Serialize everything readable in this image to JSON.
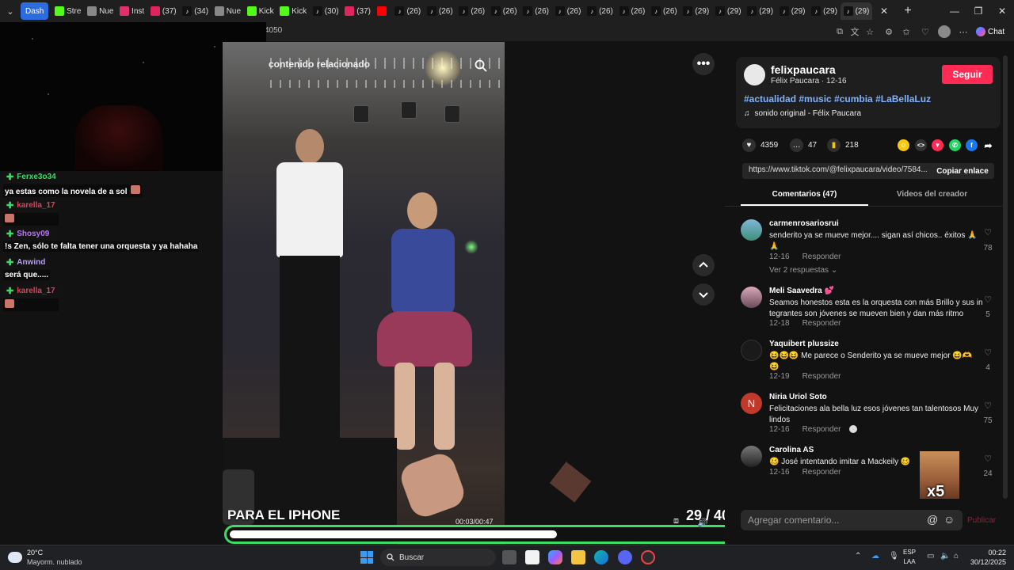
{
  "browser": {
    "tabs": [
      {
        "label": "Dash",
        "icon": "dashboard-icon"
      },
      {
        "label": "Stre",
        "icon": "kick-icon"
      },
      {
        "label": "Nue",
        "icon": "newtab-icon"
      },
      {
        "label": "Inst",
        "icon": "instagram-icon"
      },
      {
        "label": "(37)",
        "icon": "red-dot-icon"
      },
      {
        "label": "(34)",
        "icon": "tiktok-icon"
      },
      {
        "label": "Nue",
        "icon": "newtab-icon"
      },
      {
        "label": "Kick",
        "icon": "kick-icon"
      },
      {
        "label": "Kick",
        "icon": "kick-icon"
      },
      {
        "label": "(30)",
        "icon": "tiktok-icon"
      },
      {
        "label": "(37)",
        "icon": "red-dot-icon"
      },
      {
        "label": "",
        "icon": "youtube-icon"
      },
      {
        "label": "(26)",
        "icon": "tiktok-icon"
      },
      {
        "label": "(26)",
        "icon": "tiktok-icon"
      },
      {
        "label": "(26)",
        "icon": "tiktok-icon"
      },
      {
        "label": "(26)",
        "icon": "tiktok-icon"
      },
      {
        "label": "(26)",
        "icon": "tiktok-icon"
      },
      {
        "label": "(26)",
        "icon": "tiktok-icon"
      },
      {
        "label": "(26)",
        "icon": "tiktok-icon"
      },
      {
        "label": "(26)",
        "icon": "tiktok-icon"
      },
      {
        "label": "(26)",
        "icon": "tiktok-icon"
      },
      {
        "label": "(29)",
        "icon": "tiktok-icon"
      },
      {
        "label": "(29)",
        "icon": "tiktok-icon"
      },
      {
        "label": "(29)",
        "icon": "tiktok-icon"
      },
      {
        "label": "(29)",
        "icon": "tiktok-icon"
      },
      {
        "label": "(29)",
        "icon": "tiktok-icon"
      },
      {
        "label": "(29)",
        "icon": "tiktok-icon"
      }
    ],
    "address_fragment": "4050",
    "chat_label": "Chat"
  },
  "stream_chat": [
    {
      "user": "Ferxe3o34",
      "user_color": "#3ddc63",
      "message": "ya estas como la novela de a sol"
    },
    {
      "user": "karella_17",
      "user_color": "#e0405a",
      "message": ""
    },
    {
      "user": "Shosy09",
      "user_color": "#c071ff",
      "message": "!s Zen, sólo te falta tener una orquesta y ya hahaha"
    },
    {
      "user": "Anwind",
      "user_color": "#b99bff",
      "message": "será que....."
    },
    {
      "user": "karella_17",
      "user_color": "#e0405a",
      "message": ""
    }
  ],
  "video": {
    "related_label": "contenido relacionado",
    "caption": "PARA EL IPHONE",
    "time": "00:03/00:47",
    "progress": 0.64,
    "counter": "29 / 40"
  },
  "creator": {
    "username": "felixpaucara",
    "display_name": "Félix Paucara",
    "date": "12-16",
    "follow_label": "Seguir",
    "hashtags": "#actualidad #music #cumbia #LaBellaLuz",
    "sound": "sonido original - Félix Paucara"
  },
  "stats": {
    "likes": "4359",
    "comments": "47",
    "saves": "218"
  },
  "share": {
    "link": "https://www.tiktok.com/@felixpaucara/video/7584...",
    "copy_label": "Copiar enlace"
  },
  "tabs": {
    "comments": "Comentarios (47)",
    "creator_videos": "Videos del creador"
  },
  "comments": [
    {
      "user": "carmenrosariosrui",
      "text": "senderito ya se mueve mejor.... sigan así chicos.. éxitos 🙏 🙏",
      "date": "12-16",
      "reply": "Responder",
      "likes": "78",
      "replies": "Ver 2 respuestas"
    },
    {
      "user": "Meli Saavedra 💕",
      "text": "Seamos honestos esta es la orquesta con más Brillo y sus in tegrantes son jóvenes se mueven bien y dan más ritmo",
      "date": "12-18",
      "reply": "Responder",
      "likes": "5"
    },
    {
      "user": "Yaquibert plussize",
      "text": "😆😆😆 Me parece o Senderito ya se mueve mejor 😆🫶 😆",
      "date": "12-19",
      "reply": "Responder",
      "likes": "4"
    },
    {
      "user": "Niria Uriol Soto",
      "text": "Felicitaciones ala bella luz esos jóvenes tan talentosos Muy lindos",
      "date": "12-16",
      "reply": "Responder",
      "likes": "75"
    },
    {
      "user": "Carolina AS",
      "text": "🥴 José intentando imitar a Mackeily 🥴",
      "date": "12-16",
      "reply": "Responder",
      "likes": "24"
    }
  ],
  "comment_input": {
    "placeholder": "Agregar comentario...",
    "publish_label": "Publicar"
  },
  "meme_label": "x5",
  "taskbar": {
    "temp": "20°C",
    "weather": "Mayorm. nublado",
    "search": "Buscar",
    "lang_top": "ESP",
    "lang_bottom": "LAA",
    "time": "00:22",
    "date": "30/12/2025"
  }
}
